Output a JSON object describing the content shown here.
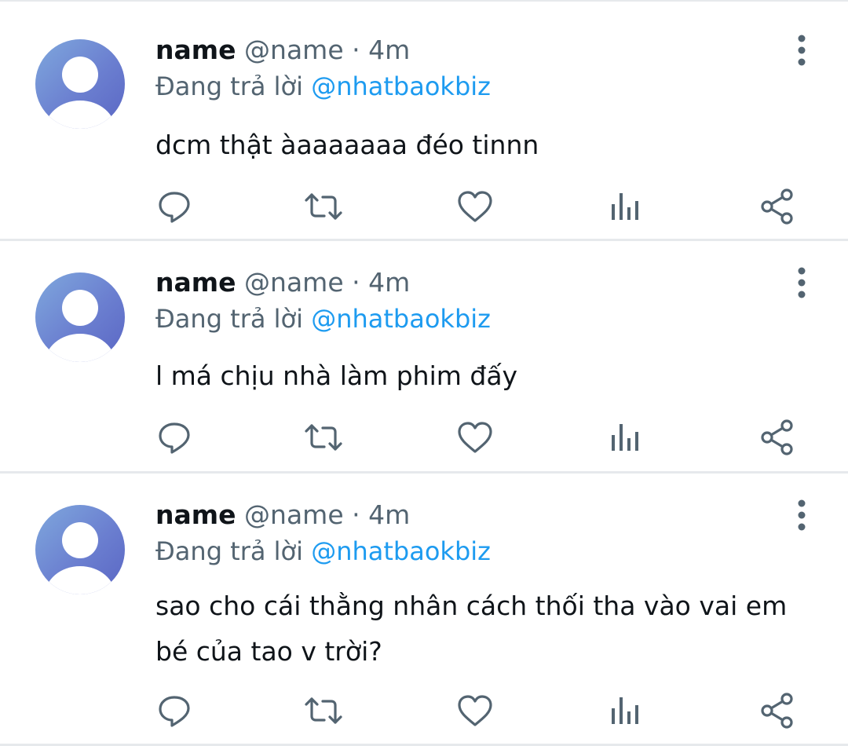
{
  "tweets": [
    {
      "display_name": "name",
      "handle": "@name",
      "separator": "·",
      "time": "4m",
      "replying_prefix": "Đang trả lời",
      "replying_to": "@nhatbaokbiz",
      "text": "dcm thật àaaaaaaa đéo tinnn"
    },
    {
      "display_name": "name",
      "handle": "@name",
      "separator": "·",
      "time": "4m",
      "replying_prefix": "Đang trả lời",
      "replying_to": "@nhatbaokbiz",
      "text": "l má chịu nhà làm phim đấy"
    },
    {
      "display_name": "name",
      "handle": "@name",
      "separator": "·",
      "time": "4m",
      "replying_prefix": "Đang trả lời",
      "replying_to": "@nhatbaokbiz",
      "text": "sao cho cái thằng nhân cách thối tha vào vai em bé của tao v trời?"
    }
  ],
  "icons": {
    "avatar": "default-avatar-icon",
    "more": "more-vertical-icon",
    "reply": "reply-icon",
    "retweet": "retweet-icon",
    "like": "heart-icon",
    "views": "analytics-icon",
    "share": "share-icon"
  },
  "colors": {
    "text_primary": "#0f1419",
    "text_secondary": "#536471",
    "mention": "#1d9bf0",
    "icon": "#536471",
    "divider": "#e6e9ec"
  }
}
